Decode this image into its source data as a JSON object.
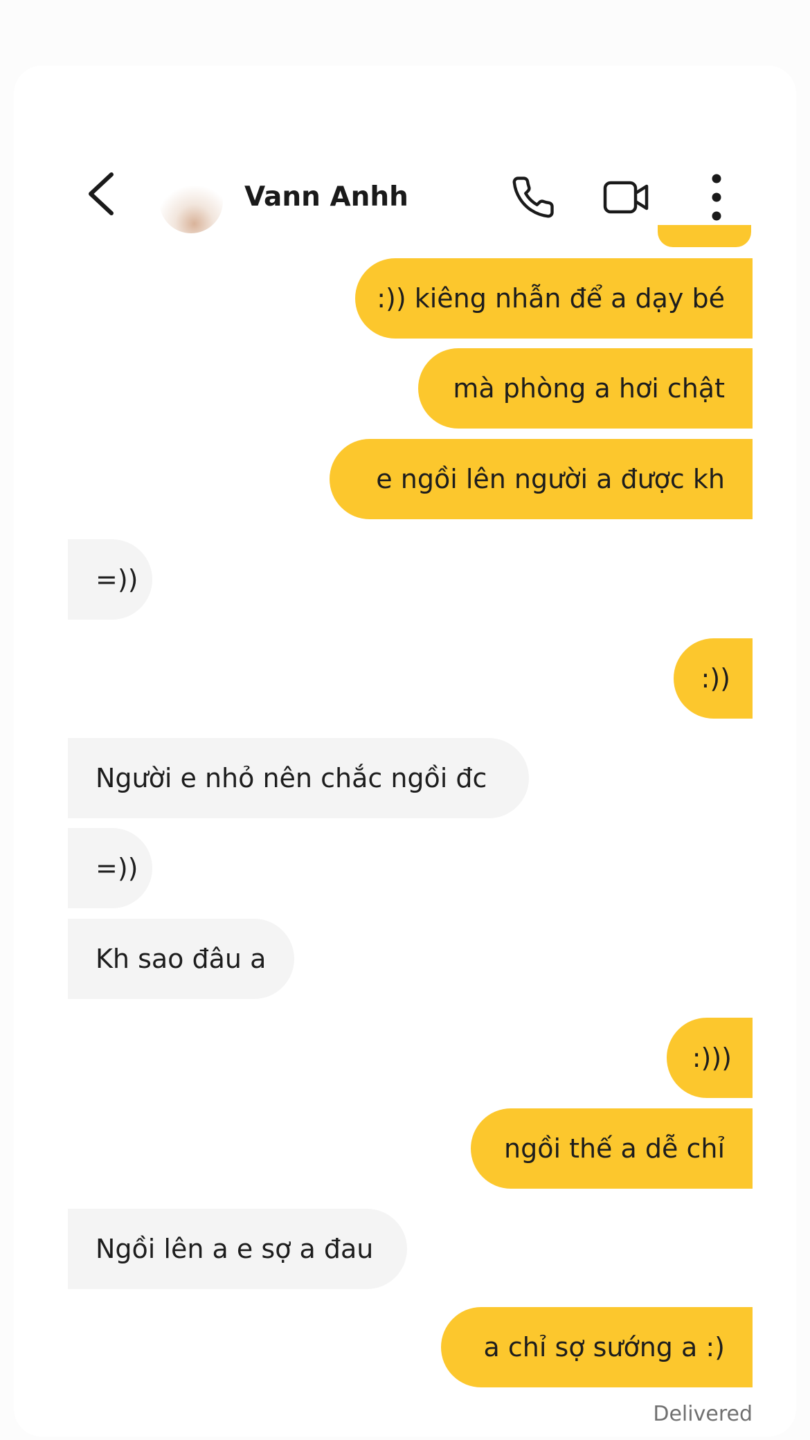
{
  "header": {
    "contact_name": "Vann Anhh",
    "back_icon": "chevron-left-icon",
    "call_icon": "phone-icon",
    "video_icon": "video-camera-icon",
    "more_icon": "more-vertical-icon"
  },
  "colors": {
    "sent_bubble": "#fcc72d",
    "received_bubble": "#f4f4f4",
    "text": "#1d1d1d"
  },
  "messages": [
    {
      "side": "sent",
      "text": ":)) kiêng nhẫn để a dạy bé"
    },
    {
      "side": "sent",
      "text": "mà phòng a hơi chật"
    },
    {
      "side": "sent",
      "text": "e ngồi lên người a được kh"
    },
    {
      "side": "received",
      "text": "=))"
    },
    {
      "side": "sent",
      "text": ":))"
    },
    {
      "side": "received",
      "text": "Người e nhỏ nên chắc ngồi đc"
    },
    {
      "side": "received",
      "text": "=))"
    },
    {
      "side": "received",
      "text": "Kh sao đâu a"
    },
    {
      "side": "sent",
      "text": ":)))"
    },
    {
      "side": "sent",
      "text": "ngồi thế a dễ chỉ"
    },
    {
      "side": "received",
      "text": "Ngồi lên a e sợ a đau"
    },
    {
      "side": "sent",
      "text": "a chỉ sợ sướng a :)"
    }
  ],
  "status": {
    "delivered": "Delivered"
  }
}
